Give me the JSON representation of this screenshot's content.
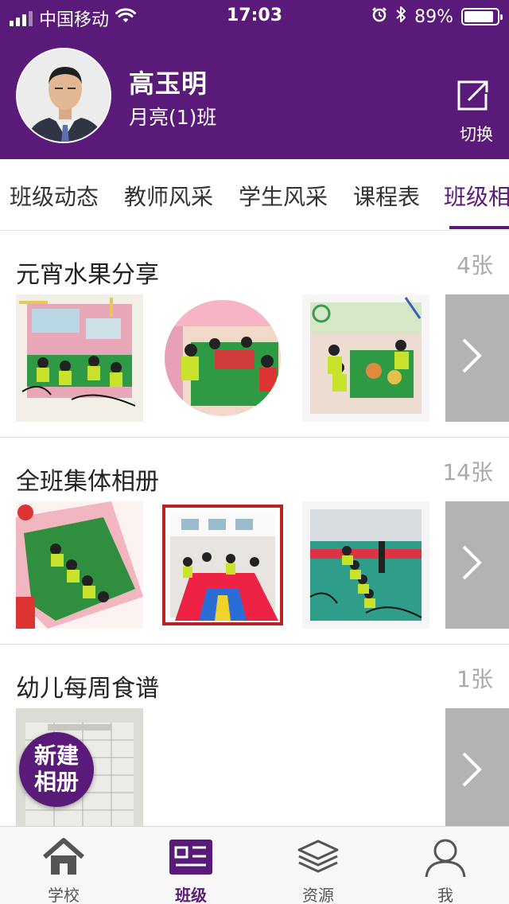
{
  "status_bar": {
    "carrier": "中国移动",
    "time": "17:03",
    "battery": "89%",
    "battery_level": 0.89,
    "signal_bars": 3
  },
  "profile": {
    "name": "高玉明",
    "class_name": "月亮(1)班",
    "switch_label": "切换"
  },
  "tabs": [
    {
      "label": "班级动态"
    },
    {
      "label": "教师风采"
    },
    {
      "label": "学生风采"
    },
    {
      "label": "课程表"
    },
    {
      "label": "班级相"
    }
  ],
  "active_tab": 4,
  "albums": [
    {
      "title": "元宵水果分享",
      "count": "4张"
    },
    {
      "title": "全班集体相册",
      "count": "14张"
    },
    {
      "title": "幼儿每周食谱",
      "count": "1张"
    }
  ],
  "fab": {
    "line1": "新建",
    "line2": "相册"
  },
  "bottom_nav": [
    {
      "label": "学校",
      "icon": "home-icon"
    },
    {
      "label": "班级",
      "icon": "class-icon"
    },
    {
      "label": "资源",
      "icon": "layers-icon"
    },
    {
      "label": "我",
      "icon": "person-icon"
    }
  ],
  "active_nav": 1,
  "colors": {
    "brand": "#5a1a7a",
    "more_button": "#b3b3b3",
    "count_text": "#aaaaaa"
  }
}
